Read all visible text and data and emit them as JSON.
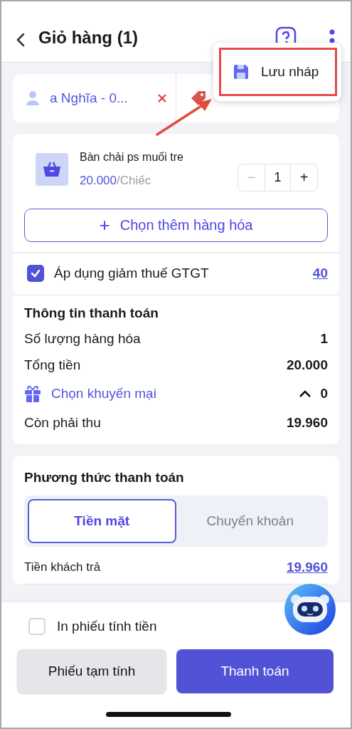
{
  "header": {
    "title": "Giỏ hàng (1)"
  },
  "chips": [
    {
      "kind": "customer",
      "label": "a Nghĩa - 0..."
    },
    {
      "kind": "price_list"
    }
  ],
  "menu": {
    "items": [
      {
        "label": "Lưu nháp",
        "highlighted": true
      }
    ]
  },
  "product": {
    "name": "Bàn chải ps muối tre",
    "price": "20.000",
    "unit": "/Chiếc",
    "quantity": "1",
    "minus": "−",
    "plus": "+"
  },
  "add_button": {
    "icon": "+",
    "label": "Chọn thêm hàng hóa"
  },
  "vat": {
    "label": "Áp dụng giảm thuế GTGT",
    "checked": true,
    "value": "40"
  },
  "payment_info": {
    "title": "Thông tin thanh toán",
    "rows": [
      {
        "kind": "plain",
        "label": "Số lượng hàng hóa",
        "value": "1"
      },
      {
        "kind": "plain",
        "label": "Tổng tiền",
        "value": "20.000"
      },
      {
        "kind": "promo",
        "label": "Chọn khuyến mại",
        "value": "0"
      },
      {
        "kind": "plain",
        "label": "Còn phải thu",
        "value": "19.960"
      }
    ]
  },
  "payment_method": {
    "title": "Phương thức thanh toán",
    "tabs": [
      {
        "label": "Tiền mặt",
        "selected": true
      },
      {
        "label": "Chuyển khoản",
        "selected": false
      }
    ],
    "customer_pays": {
      "label": "Tiền khách trả",
      "value": "19.960"
    }
  },
  "footer": {
    "print_checkbox": {
      "label": "In phiếu tính tiền",
      "checked": false
    },
    "buttons": [
      {
        "kind": "secondary",
        "label": "Phiếu tạm tính"
      },
      {
        "kind": "primary",
        "label": "Thanh toán"
      }
    ]
  }
}
